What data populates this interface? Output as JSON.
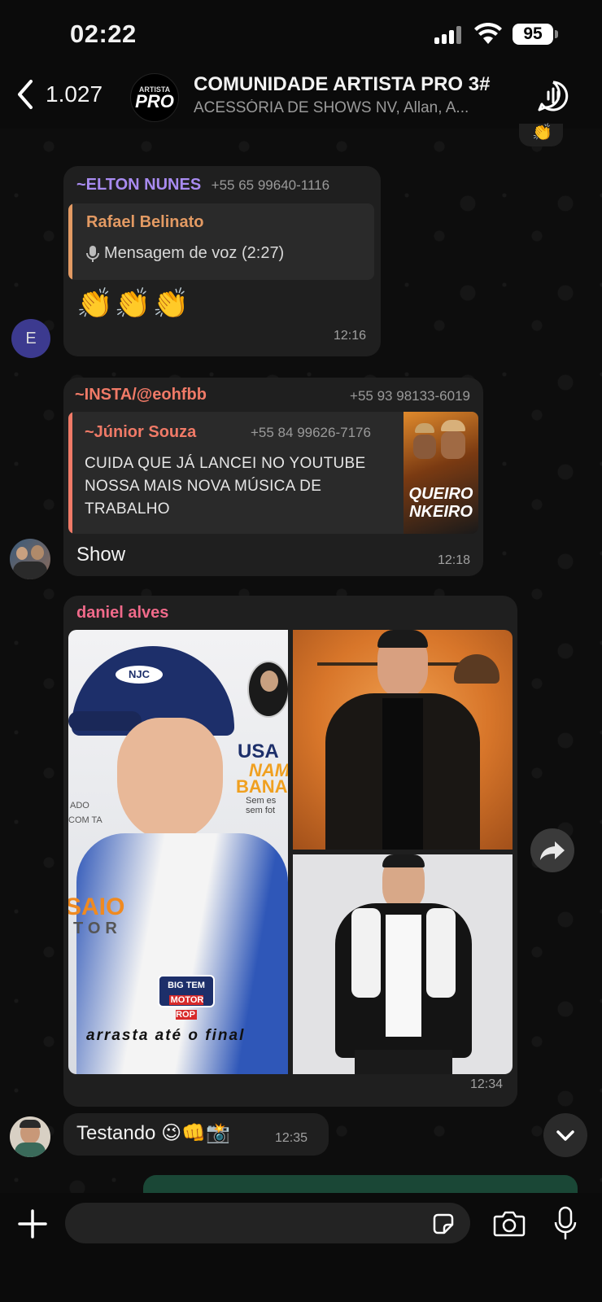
{
  "status": {
    "time": "02:22",
    "battery": "95"
  },
  "header": {
    "back_count": "1.027",
    "avatar_top": "ARTISTA",
    "avatar_main": "PRO",
    "title": "COMUNIDADE ARTISTA PRO 3#",
    "subtitle": "ACESSÓRIA DE SHOWS NV, Allan, A..."
  },
  "messages": [
    {
      "sender": "~ELTON NUNES",
      "phone": "+55 65 99640-1116",
      "reply_author": "Rafael Belinato",
      "reply_text": "Mensagem de voz (2:27)",
      "body": "👏👏👏",
      "time": "12:16",
      "avatar_letter": "E"
    },
    {
      "sender": "~INSTA/@eohfbb",
      "phone": "+55 93 98133-6019",
      "reply_author": "~Júnior Souza",
      "reply_phone": "+55 84 99626-7176",
      "reply_text": "CUIDA QUE JÁ LANCEI NO YOUTUBE NOSSA MAIS NOVA MÚSICA DE TRABALHO",
      "reply_thumb_text": "QUEIRO\nNKEIRO",
      "body": "Show",
      "time": "12:18"
    },
    {
      "sender": "daniel alves",
      "photo1_lines": [
        "USA",
        "NAM",
        "BANA",
        "Sem es",
        "sem fot",
        "SAIO",
        "TOR",
        "BIG TEM",
        "MOTOR ROP",
        "arrasta até o final",
        "ADO",
        "COM TA"
      ],
      "cap_logo": "NJC",
      "time": "12:34"
    },
    {
      "body": "Testando 😉👊📸",
      "time": "12:35"
    }
  ],
  "top_emoji": "👏"
}
